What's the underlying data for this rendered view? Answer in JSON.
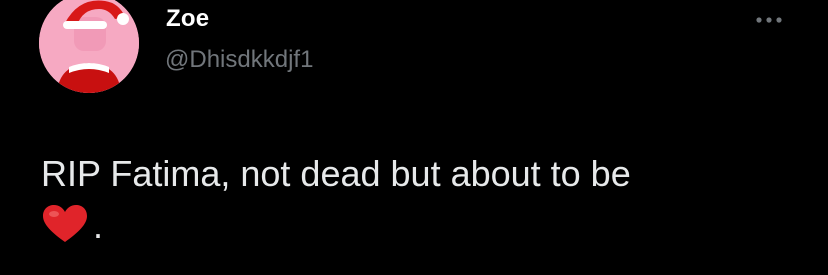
{
  "tweet": {
    "display_name": "Zoe",
    "handle": "@Dhisdkkdjf1",
    "text_line1": "RIP Fatima, not dead but about to be",
    "text_trailing": ".",
    "heart_emoji": "heart-icon",
    "more_icon": "more-dots-icon"
  },
  "colors": {
    "background": "#000000",
    "name": "#ffffff",
    "handle": "#71767b",
    "text": "#e7e9ea",
    "avatar_bg": "#f6a9c2",
    "heart": "#e0242a"
  }
}
